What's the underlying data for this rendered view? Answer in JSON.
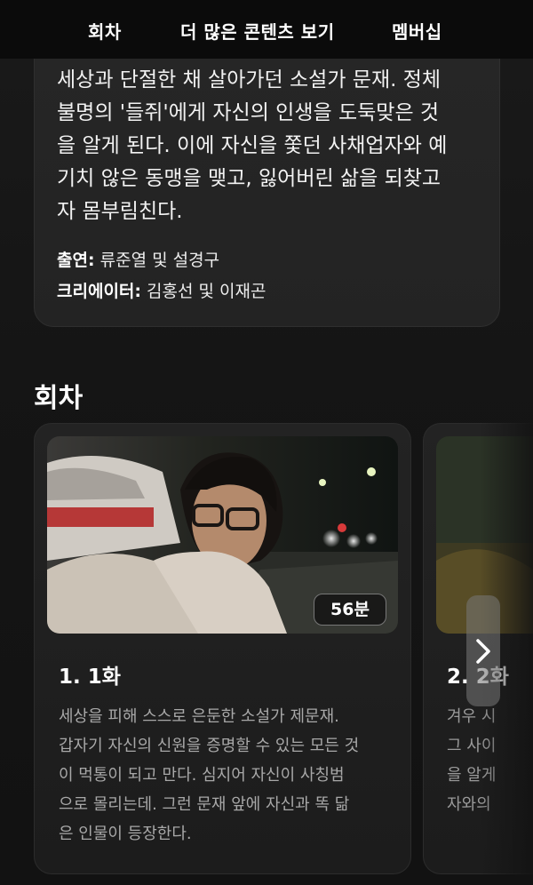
{
  "nav": {
    "episodes": "회차",
    "more_content": "더 많은 콘텐츠 보기",
    "membership": "멤버십"
  },
  "synopsis": {
    "lines": [
      "세상과 단절한 채 살아가던 소설가 문재. 정체",
      "불명의 '들쥐'에게 자신의 인생을 도둑맞은 것",
      "을 알게 된다. 이에 자신을 쫓던 사채업자와 예",
      "기치 않은 동맹을 맺고, 잃어버린 삶을 되찾고",
      "자 몸부림친다."
    ],
    "cast_label": "출연:",
    "cast_value": "류준열 및 설경구",
    "creator_label": "크리에이터:",
    "creator_value": "김홍선 및 이재곤"
  },
  "episodes_section": {
    "title": "회차",
    "items": [
      {
        "title": "1. 1화",
        "duration": "56분",
        "description_lines": [
          "세상을 피해 스스로 은둔한 소설가 제문재.",
          "갑자기 자신의 신원을 증명할 수 있는 모든 것",
          "이 먹통이 되고 만다. 심지어 자신이 사칭범",
          "으로 몰리는데. 그런 문재 앞에 자신과 똑 닮",
          "은 인물이 등장한다."
        ]
      },
      {
        "title": "2. 2화",
        "description_lines": [
          "겨우 시",
          "그 사이",
          "을 알게",
          "자와의"
        ]
      }
    ],
    "next_icon": "chevron-right-icon"
  }
}
